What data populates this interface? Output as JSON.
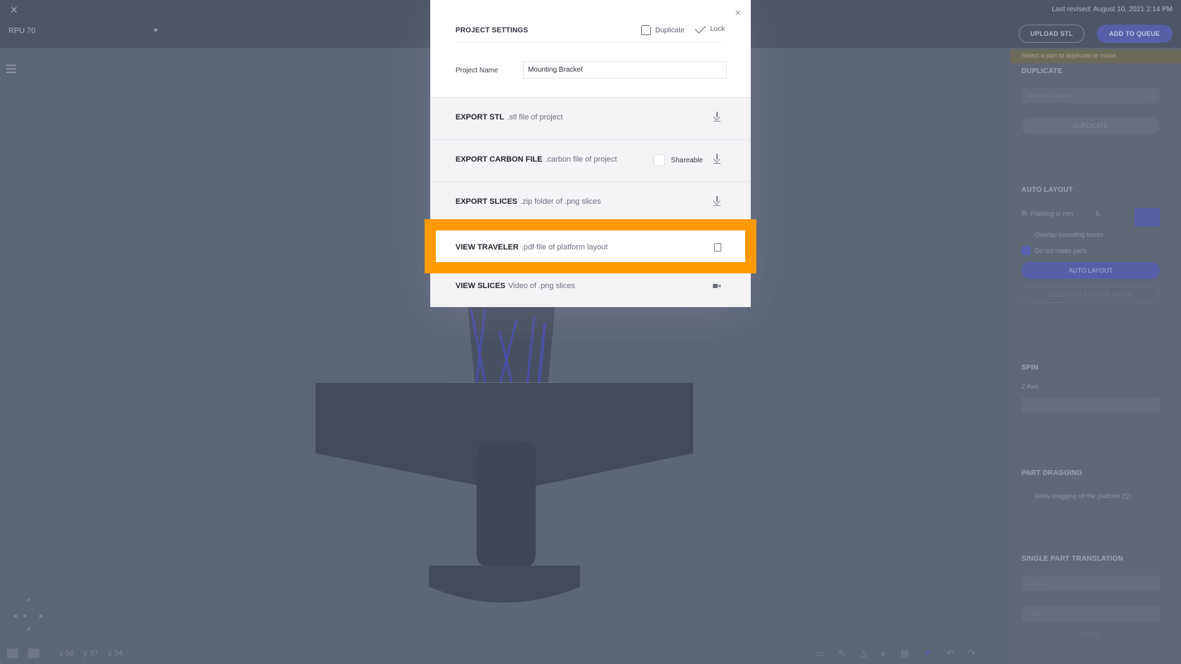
{
  "topbar": {
    "close_glyph": "✕",
    "printer": "RPU 70",
    "last_revised": "Last revised: August 10, 2021 2:14 PM",
    "upload_label": "UPLOAD STL",
    "queue_label": "ADD TO QUEUE"
  },
  "modal": {
    "title": "PROJECT SETTINGS",
    "close_glyph": "×",
    "duplicate_label": "Duplicate",
    "lock_label": "Lock",
    "project_name_label": "Project Name",
    "project_name_value": "Mounting Bracket",
    "rows": [
      {
        "title": "EXPORT STL",
        "desc": ".stl file of project",
        "icon": "download-icon"
      },
      {
        "title": "EXPORT CARBON FILE",
        "desc": ".carbon file of project",
        "icon": "download-icon",
        "extra": "Shareable"
      },
      {
        "title": "EXPORT SLICES",
        "desc": ".zip folder of .png slices",
        "icon": "download-icon"
      },
      {
        "title": "VIEW TRAVELER",
        "desc": ".pdf file of platform layout",
        "icon": "pdf-icon"
      },
      {
        "title": "VIEW SLICES",
        "desc": "Video of .png slices",
        "icon": "video-icon"
      }
    ]
  },
  "right_panel": {
    "notice": "Select a part to duplicate or move",
    "duplicate_title": "DUPLICATE",
    "duplicate_field": "Number of copies",
    "duplicate_field_value": "1",
    "duplicate_button": "DUPLICATE",
    "auto_layout_title": "AUTO LAYOUT",
    "padding_label": "Padding in mm",
    "padding_value": "5",
    "overlap_label": "Overlap bounding boxes",
    "no_rotate_label": "Do not rotate parts",
    "auto_layout_button": "AUTO LAYOUT",
    "disabled_button": "DELETE PLATFORM PARTS",
    "spin_title": "SPIN",
    "spin_label": "Z Axis",
    "part_dragging_title": "PART DRAGGING",
    "dragging_label": "Allow dragging off the platform (Q)",
    "translation_title": "SINGLE PART TRANSLATION",
    "translation_x_label": "X mm",
    "translation_y_label": "Y mm",
    "apply_label": "APPLY"
  },
  "bottombar": {
    "x_readout": "x 58",
    "y_readout": "y 37",
    "z_readout": "z 94"
  },
  "colors": {
    "highlight": "#ff9900",
    "accent": "#585fa6",
    "overlay": "#5d6578"
  }
}
